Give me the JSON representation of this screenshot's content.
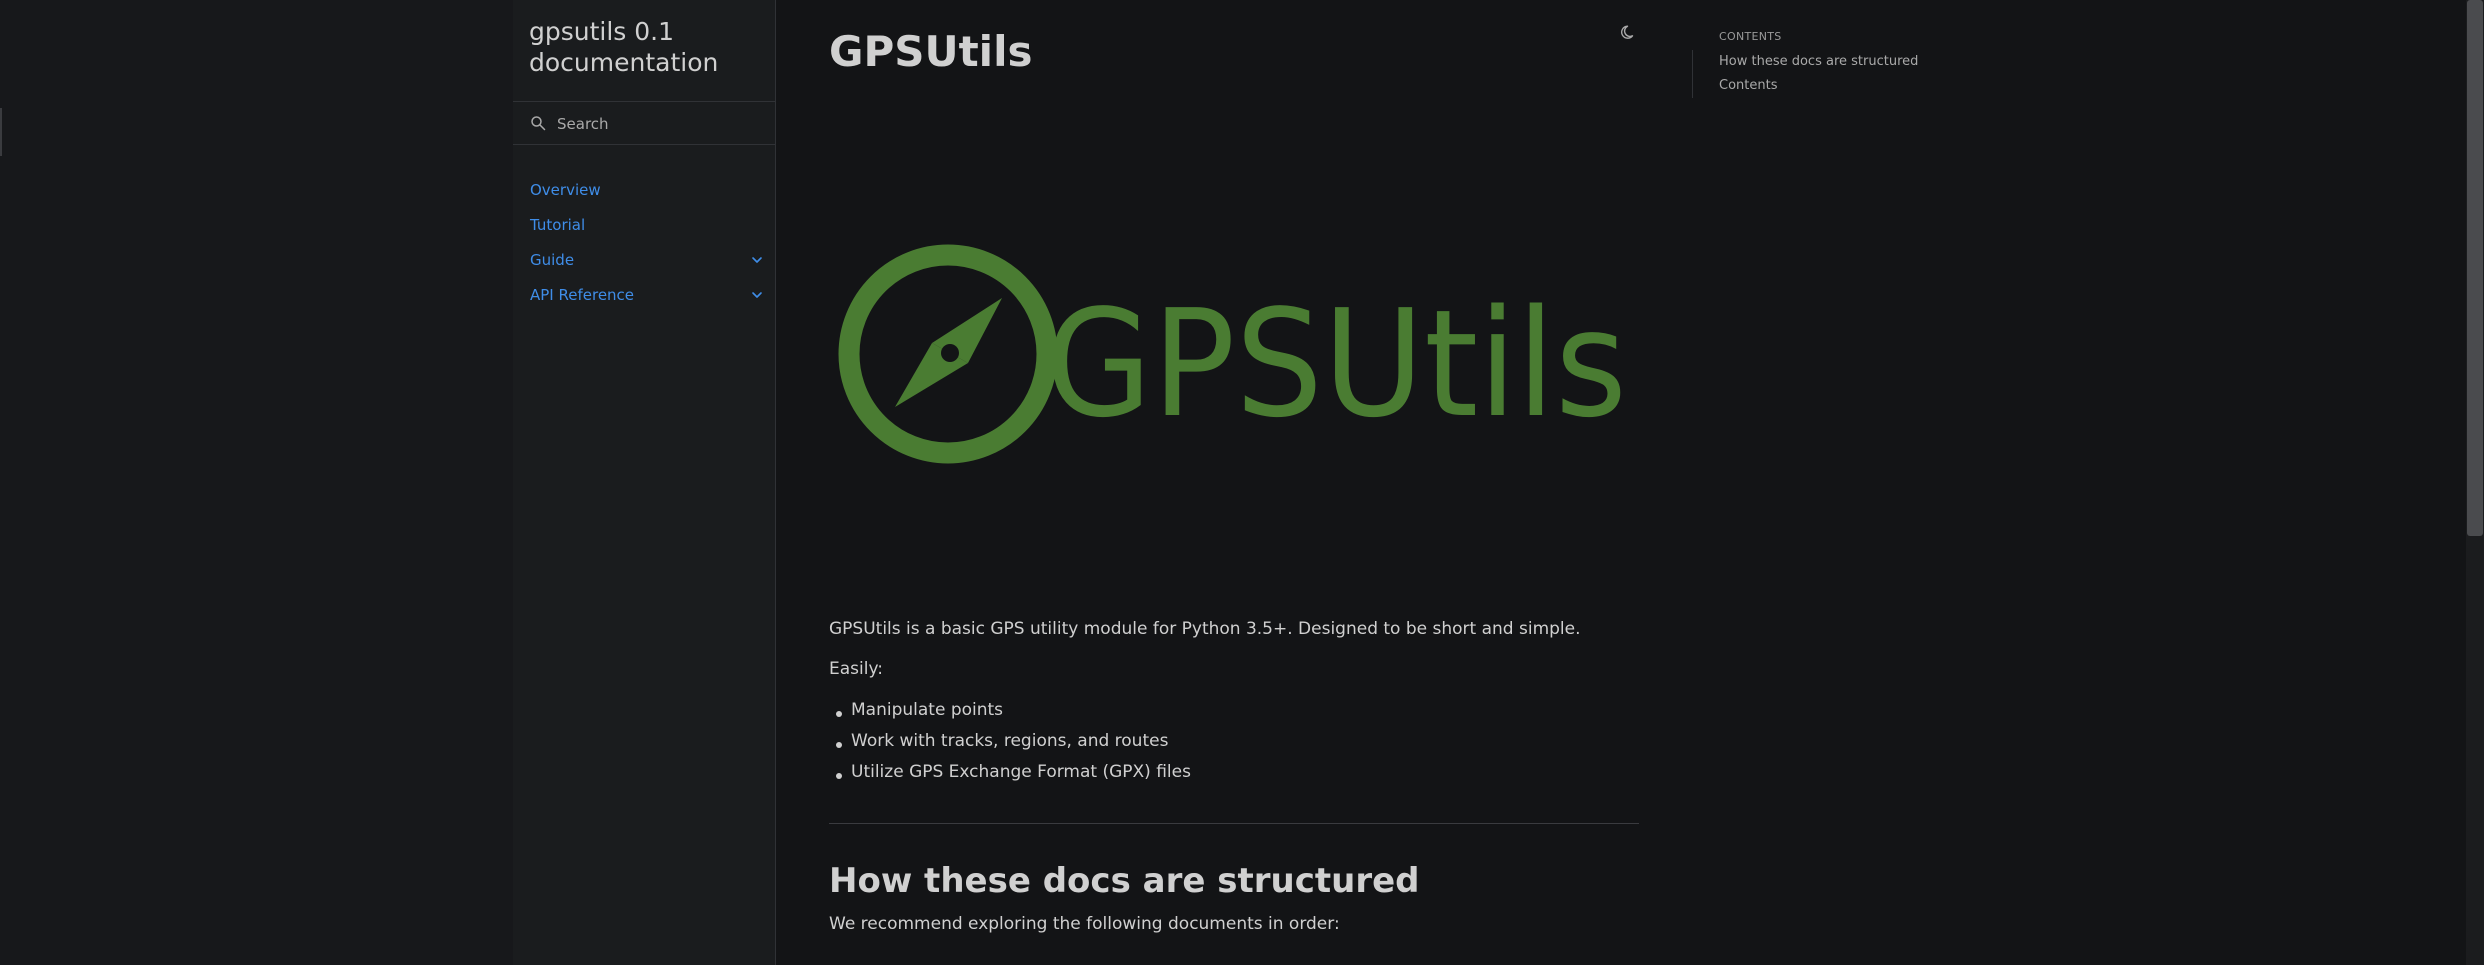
{
  "sidebar": {
    "brand": "gpsutils 0.1 documentation",
    "search_placeholder": "Search",
    "items": [
      {
        "label": "Overview",
        "expandable": false
      },
      {
        "label": "Tutorial",
        "expandable": false
      },
      {
        "label": "Guide",
        "expandable": true
      },
      {
        "label": "API Reference",
        "expandable": true
      }
    ]
  },
  "main": {
    "title": "GPSUtils",
    "logo_text": "GPSUtils",
    "intro": "GPSUtils is a basic GPS utility module for Python 3.5+. Designed to be short and simple.",
    "easily": "Easily:",
    "bullets": [
      "Manipulate points",
      "Work with tracks, regions, and routes",
      "Utilize GPS Exchange Format (GPX) files"
    ],
    "section_title": "How these docs are structured",
    "section_intro": "We recommend exploring the following documents in order:"
  },
  "toc": {
    "heading": "Contents",
    "items": [
      "How these docs are structured",
      "Contents"
    ]
  },
  "icons": {
    "search": "search-icon",
    "theme": "moon-icon",
    "chevron": "chevron-down-icon",
    "logo": "compass-icon"
  },
  "colors": {
    "background": "#131416",
    "sidebar": "#1a1c1e",
    "link": "#3f8de8",
    "logo_green": "#4a7c32",
    "text": "#d0d0d0"
  }
}
